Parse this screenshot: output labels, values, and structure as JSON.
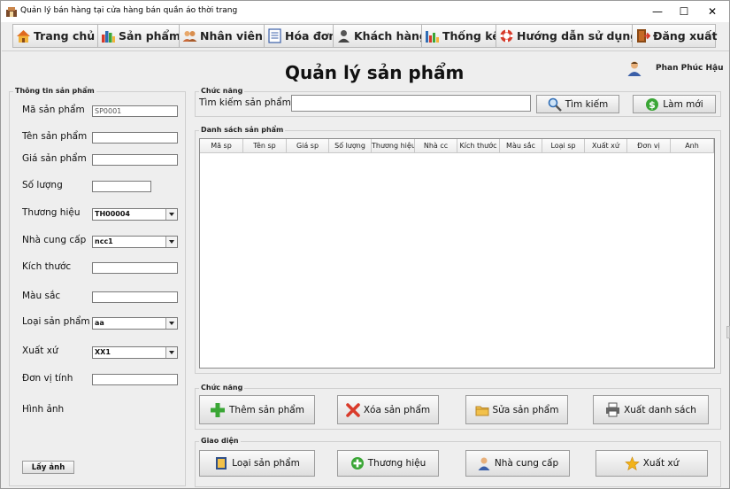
{
  "window": {
    "title": "Quản lý bán hàng tại cửa hàng bán quần áo thời trang",
    "minimize": "—",
    "maximize": "☐",
    "close": "✕"
  },
  "menu": [
    {
      "label": "Trang chủ",
      "icon": "home-icon"
    },
    {
      "label": "Sản phẩm",
      "icon": "product-icon"
    },
    {
      "label": "Nhân viên",
      "icon": "employee-icon"
    },
    {
      "label": "Hóa đơn",
      "icon": "invoice-icon"
    },
    {
      "label": "Khách hàng",
      "icon": "customer-icon"
    },
    {
      "label": "Thống kê",
      "icon": "statistics-icon"
    },
    {
      "label": "Hướng dẫn sử dụng",
      "icon": "help-icon"
    },
    {
      "label": "Đăng xuất",
      "icon": "logout-icon"
    }
  ],
  "page": {
    "title": "Quản lý sản phẩm",
    "user_name": "Phan Phúc Hậu"
  },
  "product_info": {
    "group_title": "Thông tin sản phẩm",
    "fields": {
      "code": {
        "label": "Mã sản phẩm",
        "value": "SP0001"
      },
      "name": {
        "label": "Tên sản phẩm",
        "value": ""
      },
      "price": {
        "label": "Giá sản phẩm",
        "value": ""
      },
      "quantity": {
        "label": "Số lượng",
        "value": ""
      },
      "brand": {
        "label": "Thương hiệu",
        "value": "TH00004"
      },
      "supplier": {
        "label": "Nhà cung cấp",
        "value": "ncc1"
      },
      "size": {
        "label": "Kích thước",
        "value": ""
      },
      "color": {
        "label": "Màu sắc",
        "value": ""
      },
      "type": {
        "label": "Loại sản phẩm",
        "value": "aa"
      },
      "origin": {
        "label": "Xuất xứ",
        "value": "XX1"
      },
      "unit": {
        "label": "Đơn vị tính",
        "value": ""
      },
      "image": {
        "label": "Hình ảnh"
      }
    },
    "get_image_button": "Lấy ảnh"
  },
  "search_group": {
    "title": "Chức năng",
    "label": "Tìm kiếm sản phẩm",
    "search_value": "",
    "search_button": "Tìm kiếm",
    "refresh_button": "Làm mới"
  },
  "product_list": {
    "title": "Danh sách sản phẩm",
    "columns": [
      "Mã sp",
      "Tên sp",
      "Giá sp",
      "Số lượng",
      "Thương hiệu",
      "Nhà cc",
      "Kích thước",
      "Màu sắc",
      "Loại sp",
      "Xuất xứ",
      "Đơn vị",
      "Anh"
    ],
    "rows": []
  },
  "actions": {
    "title": "Chức năng",
    "add": "Thêm sản phẩm",
    "delete": "Xóa sản phẩm",
    "edit": "Sửa sản phẩm",
    "export": "Xuất danh sách"
  },
  "interface": {
    "title": "Giao diện",
    "product_type": "Loại sản phẩm",
    "brand": "Thương hiệu",
    "supplier": "Nhà cung cấp",
    "origin": "Xuất xứ"
  },
  "colors": {
    "window_bg": "#eeeeee",
    "accent_green": "#3aa635",
    "accent_red": "#d93b2b",
    "accent_blue": "#2f6db5",
    "accent_orange": "#e88a1a"
  }
}
